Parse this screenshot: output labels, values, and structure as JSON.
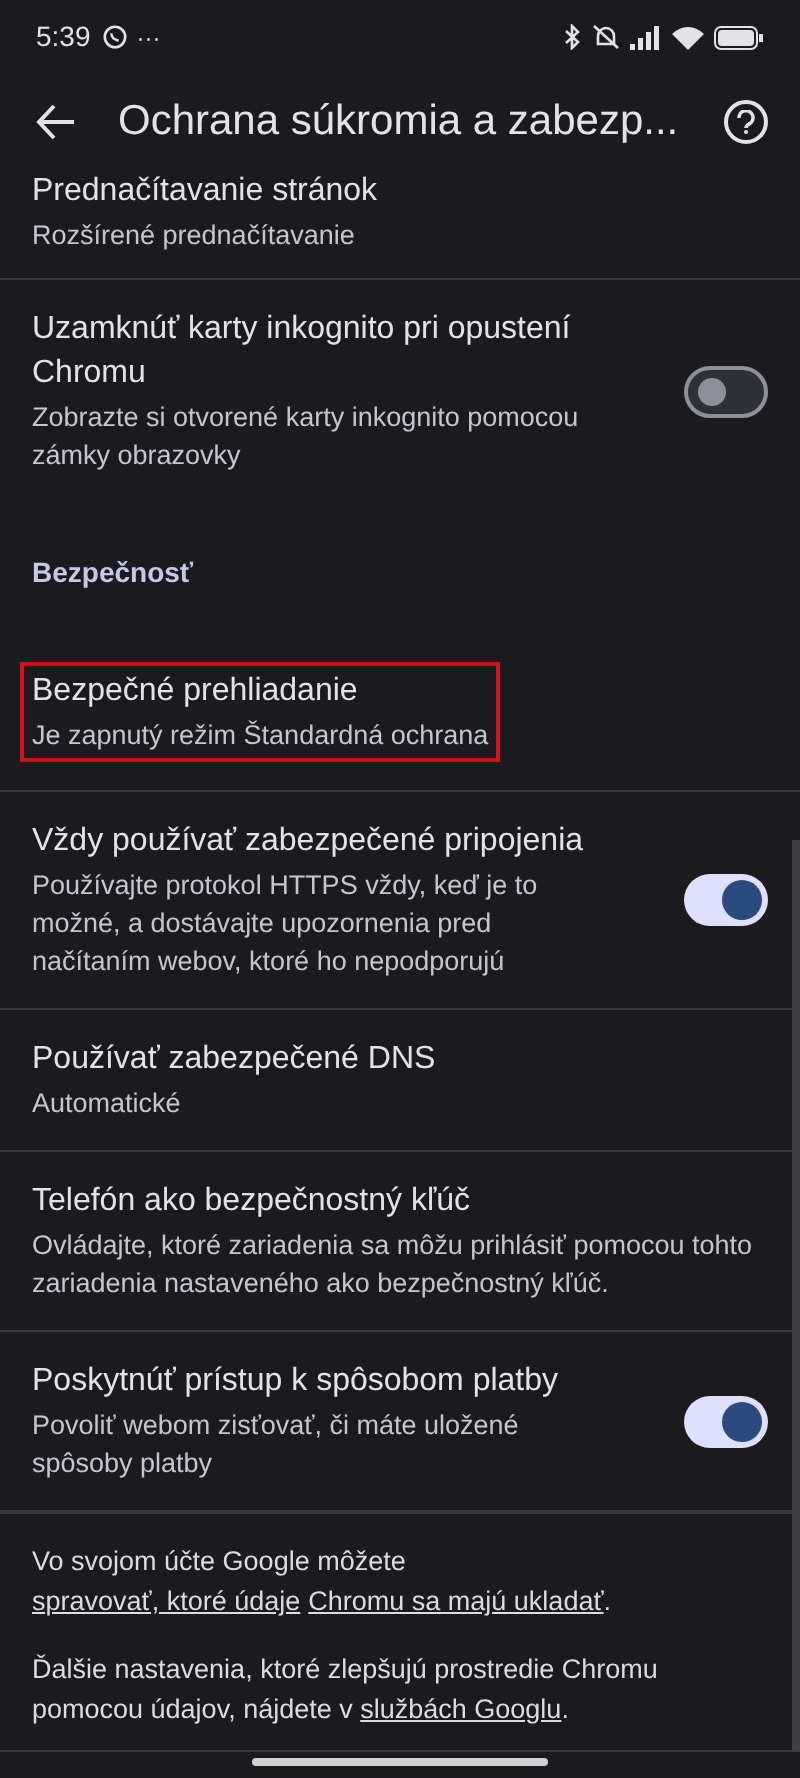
{
  "status_bar": {
    "time": "5:39",
    "more": "···"
  },
  "header": {
    "title": "Ochrana súkromia a zabezp..."
  },
  "items": [
    {
      "kind": "plain",
      "title": "Prednačítavanie stránok",
      "subtitle": "Rozšírené prednačítavanie",
      "highlighted": false
    },
    {
      "kind": "toggle",
      "title": "Uzamknúť karty inkognito pri opustení Chromu",
      "subtitle": "Zobrazte si otvorené karty inkognito pomocou zámky obrazovky",
      "on": false
    },
    {
      "kind": "section",
      "title": "Bezpečnosť"
    },
    {
      "kind": "plain",
      "title": "Bezpečné prehliadanie",
      "subtitle": "Je zapnutý režim Štandardná ochrana",
      "highlighted": true
    },
    {
      "kind": "toggle",
      "title": "Vždy používať zabezpečené pripojenia",
      "subtitle": "Používajte protokol HTTPS vždy, keď je to možné, a dostávajte upozornenia pred načítaním webov, ktoré ho nepodporujú",
      "on": true
    },
    {
      "kind": "plain",
      "title": "Používať zabezpečené DNS",
      "subtitle": "Automatické",
      "highlighted": false
    },
    {
      "kind": "plain",
      "title": "Telefón ako bezpečnostný kľúč",
      "subtitle": "Ovládajte, ktoré zariadenia sa môžu prihlásiť pomocou tohto zariadenia nastaveného ako bezpečnostný kľúč.",
      "highlighted": false
    },
    {
      "kind": "toggle",
      "title": "Poskytnúť prístup k spôsobom platby",
      "subtitle": "Povoliť webom zisťovať, či máte uložené spôsoby platby",
      "on": true
    }
  ],
  "footer": [
    [
      {
        "text": "Vo svojom účte Google môžete "
      },
      {
        "link": "spravovať, ktoré údaje"
      },
      {
        "link": "Chromu sa majú ukladať"
      },
      {
        "text": "."
      }
    ],
    [
      {
        "text": "Ďalšie nastavenia, ktoré zlepšujú prostredie Chromu pomocou údajov, nájdete v "
      },
      {
        "link": "službách Googlu"
      },
      {
        "text": "."
      }
    ]
  ]
}
